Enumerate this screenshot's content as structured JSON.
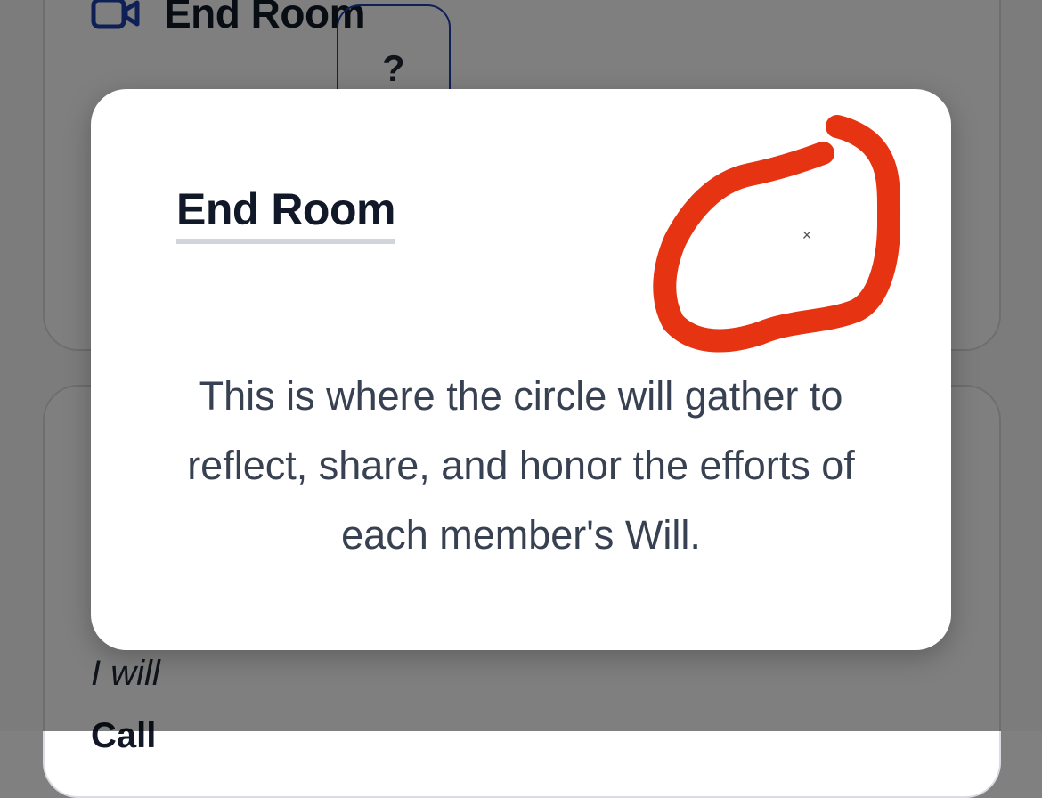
{
  "background": {
    "card_title": "End Room",
    "help_label": "?",
    "i_will": "I will",
    "partial_text": "Call"
  },
  "modal": {
    "title": "End Room",
    "close_label": "×",
    "description": "This is where the circle will gather to reflect, share, and honor the efforts of each member's Will."
  },
  "colors": {
    "accent": "#1e40af",
    "annotation": "#e63312",
    "overlay": "rgba(0,0,0,0.5)"
  },
  "icons": [
    "video-camera-icon",
    "close-icon"
  ]
}
